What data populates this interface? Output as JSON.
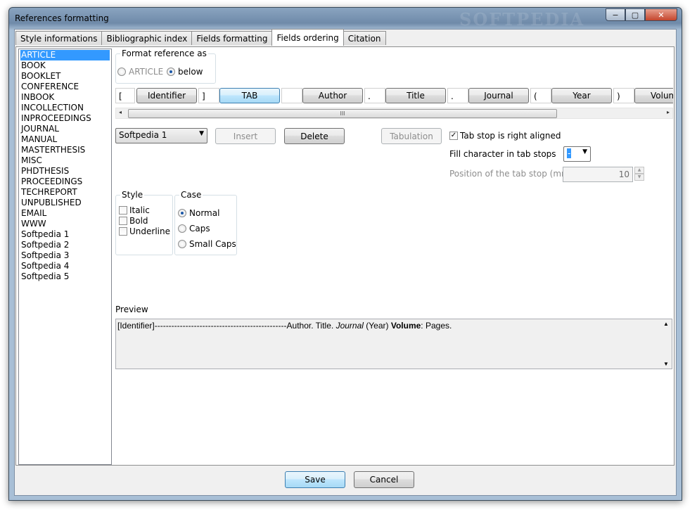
{
  "window": {
    "title": "References formatting",
    "watermark": "SOFTPEDIA",
    "min_glyph": "−",
    "max_glyph": "▢",
    "close_glyph": "✕"
  },
  "tabs": [
    {
      "label": "Style informations"
    },
    {
      "label": "Bibliographic index"
    },
    {
      "label": "Fields formatting"
    },
    {
      "label": "Fields ordering",
      "active": true
    },
    {
      "label": "Citation"
    }
  ],
  "entry_types": [
    "ARTICLE",
    "BOOK",
    "BOOKLET",
    "CONFERENCE",
    "INBOOK",
    "INCOLLECTION",
    "INPROCEEDINGS",
    "JOURNAL",
    "MANUAL",
    "MASTERTHESIS",
    "MISC",
    "PHDTHESIS",
    "PROCEEDINGS",
    "TECHREPORT",
    "UNPUBLISHED",
    "EMAIL",
    "WWW",
    "Softpedia 1",
    "Softpedia 2",
    "Softpedia 3",
    "Softpedia 4",
    "Softpedia 5"
  ],
  "selected_entry_type": "ARTICLE",
  "format_as": {
    "legend": "Format reference as",
    "option_type": "ARTICLE",
    "option_below": "below",
    "selected": "below"
  },
  "field_sequence": {
    "sep1": "[",
    "field1": "Identifier",
    "sep2": "]",
    "field2": "TAB",
    "sep3": "",
    "field3": "Author",
    "sep4": ".",
    "field4": "Title",
    "sep5": ".",
    "field5": "Journal",
    "sep6": "(",
    "field6": "Year",
    "sep7": ")",
    "field7": "Volum"
  },
  "scrollbar": {
    "grip": "III",
    "left_arrow": "◂",
    "right_arrow": "▸"
  },
  "actions": {
    "field_select": "Softpedia 1",
    "insert": "Insert",
    "delete": "Delete",
    "tabulation": "Tabulation"
  },
  "tabstop": {
    "right_aligned_label": "Tab stop is right aligned",
    "right_aligned_checked": true,
    "fill_char_label": "Fill character in tab stops",
    "fill_char_value": "-",
    "position_label": "Position of the tab stop (mm)",
    "position_value": "10"
  },
  "style_group": {
    "legend": "Style",
    "italic": "Italic",
    "bold": "Bold",
    "underline": "Underline"
  },
  "case_group": {
    "legend": "Case",
    "normal": "Normal",
    "caps": "Caps",
    "small_caps": "Small Caps",
    "selected": "Normal"
  },
  "preview": {
    "label": "Preview",
    "identifier": "[Identifier]",
    "leader": "-----------------------------------------------",
    "author": "Author. Title. ",
    "journal": "Journal",
    "year": " (Year) ",
    "volume": "Volume",
    "pages": ": Pages."
  },
  "footer": {
    "save": "Save",
    "cancel": "Cancel"
  }
}
